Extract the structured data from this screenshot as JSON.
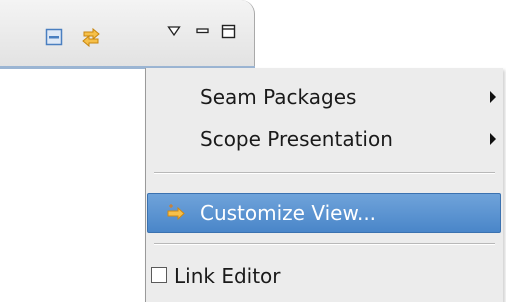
{
  "toolbar": {
    "buttons": [
      {
        "name": "collapse-all-icon",
        "icon": "collapse-all"
      },
      {
        "name": "link-with-editor-icon",
        "icon": "link-arrows"
      },
      {
        "name": "view-menu-icon",
        "icon": "triangle-down"
      },
      {
        "name": "minimize-icon",
        "icon": "minimize"
      },
      {
        "name": "maximize-icon",
        "icon": "maximize"
      }
    ],
    "colors": {
      "collapse_blue": "#4a7fc0",
      "arrows_orange": "#f2a51e",
      "underline": "#9bb5d3"
    }
  },
  "menu": {
    "items": [
      {
        "label": "Seam Packages",
        "submenu": true
      },
      {
        "label": "Scope Presentation",
        "submenu": true
      },
      {
        "label": "Customize View...",
        "selected": true,
        "icon": "customize-arrow-icon"
      },
      {
        "label": "Link Editor",
        "checkbox": true,
        "checked": false
      }
    ],
    "selection_color": "#4a86c9"
  }
}
